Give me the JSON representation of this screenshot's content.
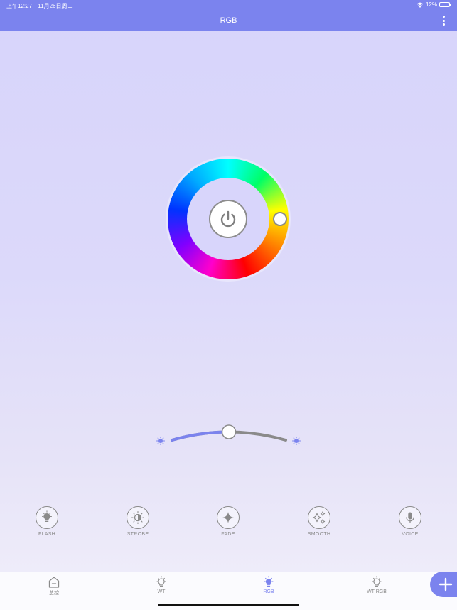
{
  "status_bar": {
    "time": "上午12:27",
    "date": "11月26日周二",
    "battery_text": "12%",
    "battery_level": 0.12
  },
  "header": {
    "title": "RGB"
  },
  "brightness": {
    "level": 0.5
  },
  "modes": [
    {
      "label": "FLASH",
      "icon": "bulb-icon"
    },
    {
      "label": "STROBE",
      "icon": "strobe-icon"
    },
    {
      "label": "FADE",
      "icon": "sparkle-icon"
    },
    {
      "label": "SMOOTH",
      "icon": "sparkles-icon"
    },
    {
      "label": "VOICE",
      "icon": "microphone-icon"
    }
  ],
  "tabs": [
    {
      "label": "总控",
      "icon": "home-icon",
      "active": false
    },
    {
      "label": "WT",
      "icon": "bulb-icon",
      "active": false
    },
    {
      "label": "RGB",
      "icon": "bulb-icon",
      "active": true
    },
    {
      "label": "WT RGB",
      "icon": "bulb-icon",
      "active": false
    }
  ],
  "colors": {
    "accent": "#7b83ee",
    "background": "#d8d5fb",
    "slider_track_active": "#7b83ee",
    "slider_track_inactive": "#8a8a8a"
  }
}
